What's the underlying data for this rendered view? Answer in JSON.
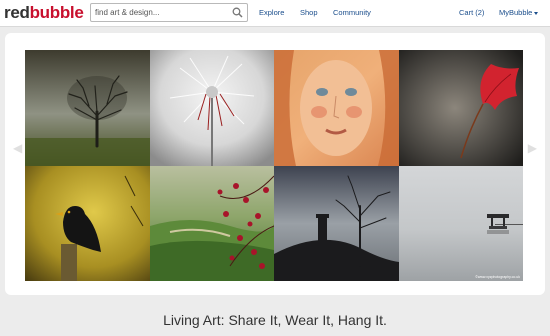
{
  "header": {
    "logo_part1": "red",
    "logo_part2": "bubble",
    "search_placeholder": "find art & design...",
    "nav": {
      "explore": "Explore",
      "shop": "Shop",
      "community": "Community",
      "cart": "Cart (2)",
      "mybubble": "MyBubble"
    }
  },
  "gallery": {
    "tiles": [
      {
        "subject": "lone tree in misty field"
      },
      {
        "subject": "dandelion seed head"
      },
      {
        "subject": "painted portrait of a woman"
      },
      {
        "subject": "red leaf on dark background"
      },
      {
        "subject": "blackbird on post"
      },
      {
        "subject": "red blossom branches over green hills"
      },
      {
        "subject": "tower on hill with bare tree"
      },
      {
        "subject": "pier shelter on calm water"
      }
    ],
    "tile8_credit": "©www.xyzphotography.co.uk"
  },
  "tagline": "Living Art: Share It, Wear It, Hang It.",
  "colors": {
    "brand_red": "#c8102e",
    "link_blue": "#1b4e8c"
  }
}
